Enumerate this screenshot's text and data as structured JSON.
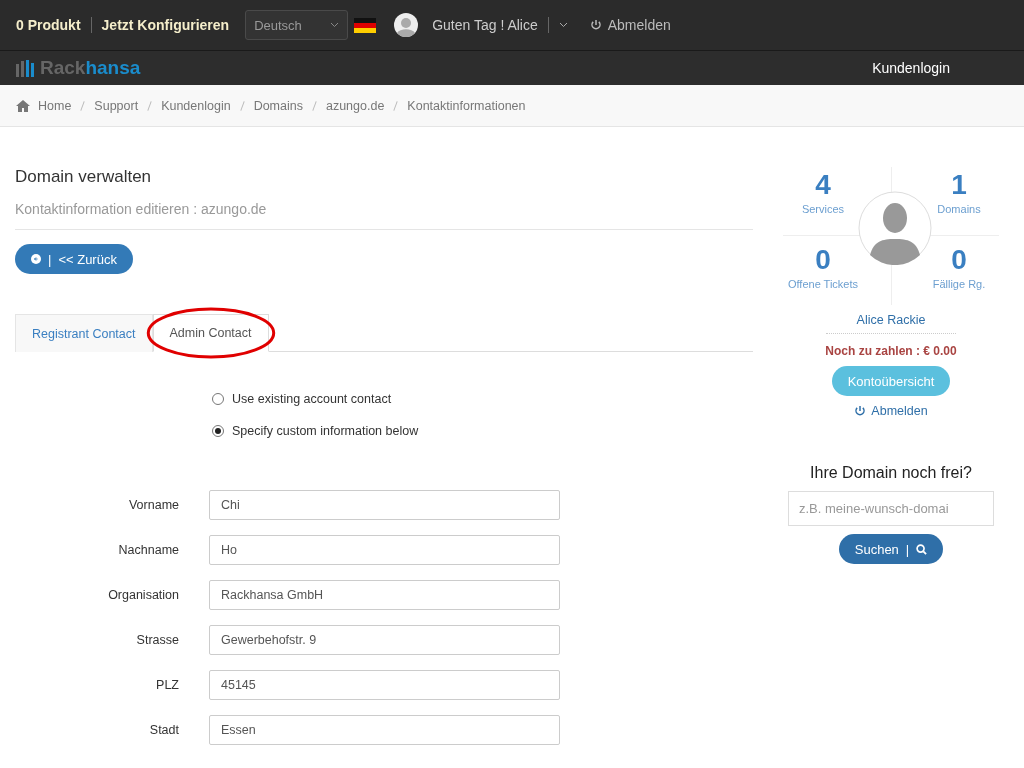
{
  "topbar": {
    "cart": "0 Produkt",
    "configure": "Jetzt Konfigurieren",
    "language": "Deutsch",
    "greeting": "Guten Tag ! Alice",
    "logout": "Abmelden"
  },
  "navbar": {
    "logo_dark": "Rack",
    "logo_accent": "hansa",
    "link": "Kundenlogin"
  },
  "breadcrumb": [
    "Home",
    "Support",
    "Kundenlogin",
    "Domains",
    "azungo.de",
    "Kontaktinformationen"
  ],
  "page": {
    "title": "Domain verwalten",
    "subtitle": "Kontaktinformation editieren : azungo.de",
    "back_button": {
      "separator": "|",
      "label": "<< Zurück"
    }
  },
  "tabs": [
    {
      "label": "Registrant Contact",
      "selected": false,
      "circled": false
    },
    {
      "label": "Admin Contact",
      "selected": true,
      "circled": true
    }
  ],
  "radios": [
    {
      "label": "Use existing account contact",
      "selected": false
    },
    {
      "label": "Specify custom information below",
      "selected": true
    }
  ],
  "fields": [
    {
      "label": "Vorname",
      "value": "Chi"
    },
    {
      "label": "Nachname",
      "value": "Ho"
    },
    {
      "label": "Organisation",
      "value": "Rackhansa GmbH"
    },
    {
      "label": "Strasse",
      "value": "Gewerbehofstr. 9"
    },
    {
      "label": "PLZ",
      "value": "45145"
    },
    {
      "label": "Stadt",
      "value": "Essen"
    }
  ],
  "sidebar": {
    "stats": [
      {
        "value": "4",
        "label": "Services"
      },
      {
        "value": "1",
        "label": "Domains"
      },
      {
        "value": "0",
        "label": "Offene Tickets"
      },
      {
        "value": "0",
        "label": "Fällige Rg."
      }
    ],
    "name": "Alice Rackie",
    "balance": "Noch zu zahlen : € 0.00",
    "account_button": "Kontoübersicht",
    "logout": "Abmelden",
    "domain_search": {
      "title": "Ihre Domain noch frei?",
      "placeholder": "z.B. meine-wunsch-domai",
      "button": "Suchen",
      "separator": "|"
    }
  }
}
